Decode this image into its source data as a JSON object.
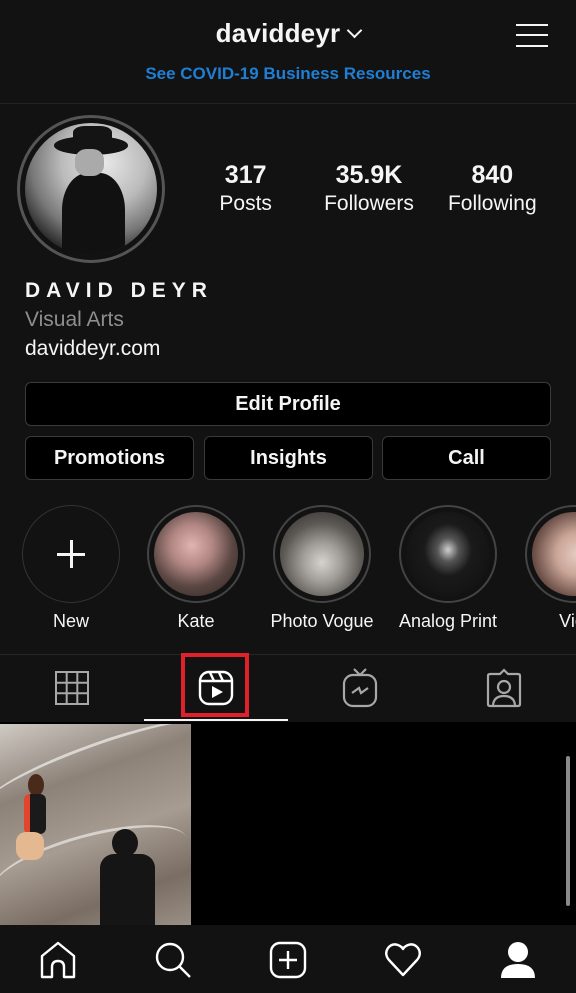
{
  "header": {
    "username": "daviddeyr",
    "menu_icon": "hamburger-menu-icon",
    "banner": "See COVID-19 Business Resources",
    "banner_color": "#1f7fd4"
  },
  "profile": {
    "avatar_icon": "profile-avatar",
    "stats": [
      {
        "value": "317",
        "label": "Posts"
      },
      {
        "value": "35.9K",
        "label": "Followers"
      },
      {
        "value": "840",
        "label": "Following"
      }
    ],
    "display_name": "DAVID DEYR",
    "category": "Visual Arts",
    "website": "daviddeyr.com"
  },
  "actions": {
    "edit_profile": "Edit Profile",
    "promotions": "Promotions",
    "insights": "Insights",
    "call": "Call"
  },
  "highlights": [
    {
      "label": "New",
      "icon": "plus-icon"
    },
    {
      "label": "Kate"
    },
    {
      "label": "Photo Vogue"
    },
    {
      "label": "Analog Print"
    },
    {
      "label": "Vict"
    }
  ],
  "tabs": [
    {
      "name": "grid",
      "icon": "grid-icon",
      "active": false
    },
    {
      "name": "reels",
      "icon": "reels-icon",
      "active": true,
      "highlighted": true
    },
    {
      "name": "igtv",
      "icon": "igtv-icon",
      "active": false
    },
    {
      "name": "tagged",
      "icon": "tagged-icon",
      "active": false
    }
  ],
  "annotation": {
    "highlight_color": "#e0212b"
  },
  "bottom_nav": [
    {
      "name": "home",
      "icon": "home-icon"
    },
    {
      "name": "search",
      "icon": "search-icon"
    },
    {
      "name": "new-post",
      "icon": "add-post-icon"
    },
    {
      "name": "activity",
      "icon": "heart-icon"
    },
    {
      "name": "profile",
      "icon": "profile-icon",
      "active": true
    }
  ]
}
